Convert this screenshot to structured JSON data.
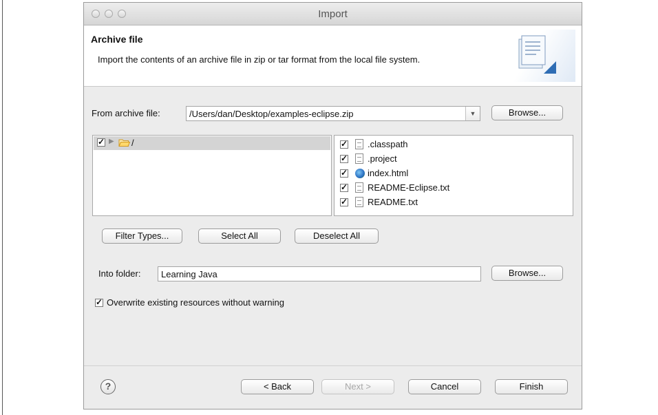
{
  "window": {
    "title": "Import"
  },
  "banner": {
    "title": "Archive file",
    "description": "Import the contents of an archive file in zip or tar format from the local file system."
  },
  "archive": {
    "label": "From archive file:",
    "value": "/Users/dan/Desktop/examples-eclipse.zip",
    "browse_label": "Browse..."
  },
  "tree": {
    "root_label": "/",
    "root_checked": true
  },
  "files": [
    {
      "name": ".classpath",
      "icon": "file-icon",
      "checked": true
    },
    {
      "name": ".project",
      "icon": "file-icon",
      "checked": true
    },
    {
      "name": "index.html",
      "icon": "globe-icon",
      "checked": true
    },
    {
      "name": "README-Eclipse.txt",
      "icon": "file-icon",
      "checked": true
    },
    {
      "name": "README.txt",
      "icon": "file-icon",
      "checked": true
    }
  ],
  "selection_buttons": {
    "filter_types": "Filter Types...",
    "select_all": "Select All",
    "deselect_all": "Deselect All"
  },
  "into_folder": {
    "label": "Into folder:",
    "value": "Learning Java",
    "browse_label": "Browse..."
  },
  "overwrite": {
    "label": "Overwrite existing resources without warning",
    "checked": true
  },
  "footer": {
    "help": "?",
    "back": "< Back",
    "next": "Next >",
    "cancel": "Cancel",
    "finish": "Finish"
  },
  "checkmark": "✓"
}
